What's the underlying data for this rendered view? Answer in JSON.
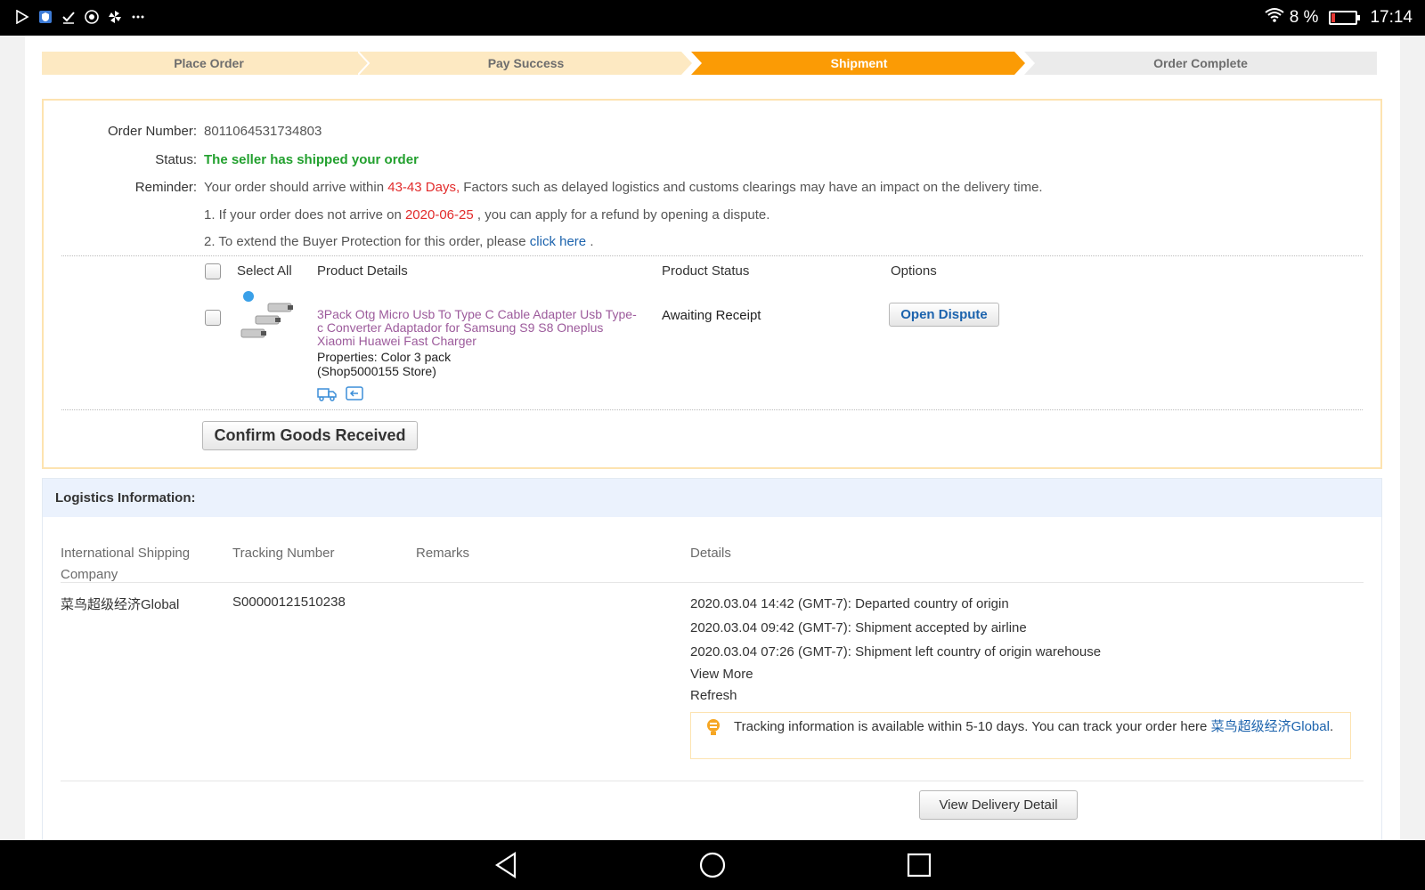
{
  "status_bar": {
    "battery": "8 %",
    "time": "17:14",
    "icons": [
      "play-store-icon",
      "shield-app-icon",
      "check-icon",
      "chrome-icon",
      "pinwheel-icon",
      "more-dots-icon"
    ]
  },
  "steps": [
    {
      "label": "Place Order",
      "state": "done"
    },
    {
      "label": "Pay Success",
      "state": "done"
    },
    {
      "label": "Shipment",
      "state": "active"
    },
    {
      "label": "Order Complete",
      "state": "todo"
    }
  ],
  "order": {
    "number_label": "Order Number:",
    "number": "8011064531734803",
    "status_label": "Status:",
    "status": "The seller has shipped your order",
    "reminder_label": "Reminder:",
    "reminder_pre": "Your order should arrive within",
    "reminder_days": "43-43 Days,",
    "reminder_post": "Factors such as delayed logistics and customs clearings may have an impact on the delivery time.",
    "note1_pre": "1. If your order does not arrive on",
    "note1_date": "2020-06-25",
    "note1_post": ", you can apply for a refund by opening a dispute.",
    "note2_pre": "2. To extend the Buyer Protection for this order, please",
    "note2_link": "click here",
    "note2_post": "."
  },
  "table": {
    "select_all": "Select All",
    "col_details": "Product Details",
    "col_status": "Product Status",
    "col_options": "Options"
  },
  "product": {
    "title": "3Pack Otg Micro Usb To Type C Cable Adapter Usb Type-c Converter Adaptador for Samsung S9 S8 Oneplus Xiaomi Huawei Fast Charger",
    "properties": "Properties: Color 3 pack",
    "store": "(Shop5000155 Store)",
    "status": "Awaiting Receipt",
    "dispute_button": "Open Dispute"
  },
  "confirm_button": "Confirm Goods Received",
  "logistics": {
    "heading": "Logistics Information:",
    "col_company": "International Shipping Company",
    "col_tracking": "Tracking Number",
    "col_remarks": "Remarks",
    "col_details": "Details",
    "company": "菜鸟超级经济Global",
    "tracking": "S00000121510238",
    "events": [
      "2020.03.04 14:42 (GMT-7): Departed country of origin",
      "2020.03.04 09:42 (GMT-7): Shipment accepted by airline",
      "2020.03.04 07:26 (GMT-7): Shipment left country of origin warehouse"
    ],
    "view_more": "View More",
    "refresh": "Refresh",
    "tip_text": "Tracking information is available within 5-10 days. You can track your order here",
    "tip_link": "菜鸟超级经济Global",
    "tip_end": ".",
    "delivery_button": "View Delivery Detail"
  },
  "colors": {
    "step_done": "#fde9c2",
    "step_active": "#fb9b05",
    "step_todo": "#ebebeb",
    "status_green": "#22a02e",
    "highlight_red": "#e22b2b",
    "link_blue": "#1c63ad",
    "product_link": "#9c5a9b"
  }
}
